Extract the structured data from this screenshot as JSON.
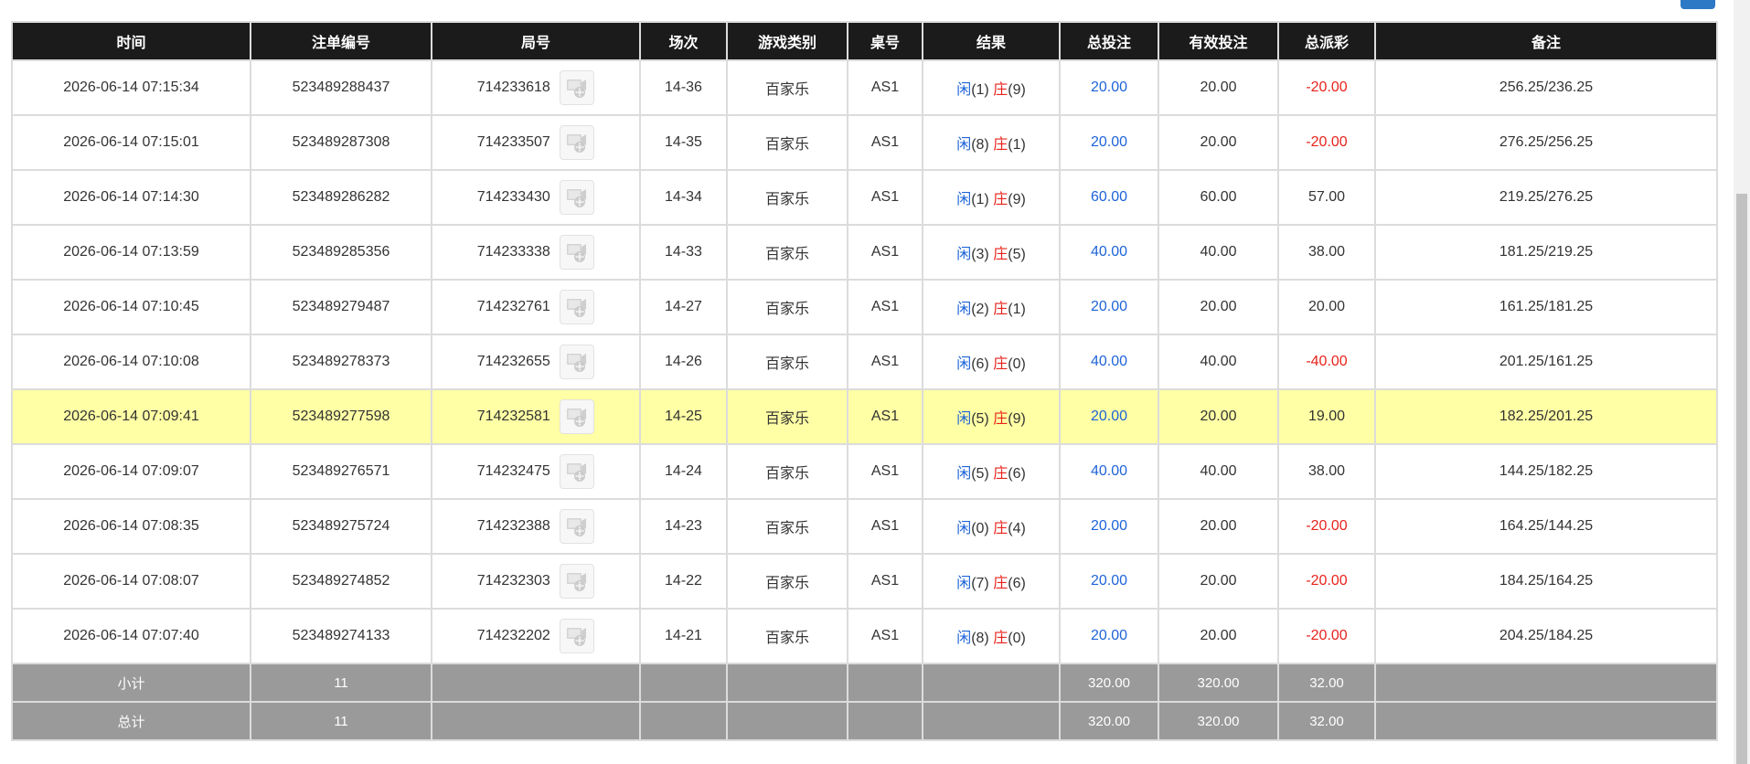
{
  "table": {
    "headers": [
      "时间",
      "注单编号",
      "局号",
      "场次",
      "游戏类别",
      "桌号",
      "结果",
      "总投注",
      "有效投注",
      "总派彩",
      "备注"
    ],
    "rows": [
      {
        "time": "2026-06-14 07:15:34",
        "bet_id": "523489288437",
        "round_id": "714233618",
        "session": "14-36",
        "game_type": "百家乐",
        "table_no": "AS1",
        "player_label": "闲",
        "player_score": "(1)",
        "banker_label": "庄",
        "banker_score": "(9)",
        "total_bet": "20.00",
        "valid_bet": "20.00",
        "payout": "-20.00",
        "note": "256.25/236.25"
      },
      {
        "time": "2026-06-14 07:15:01",
        "bet_id": "523489287308",
        "round_id": "714233507",
        "session": "14-35",
        "game_type": "百家乐",
        "table_no": "AS1",
        "player_label": "闲",
        "player_score": "(8)",
        "banker_label": "庄",
        "banker_score": "(1)",
        "total_bet": "20.00",
        "valid_bet": "20.00",
        "payout": "-20.00",
        "note": "276.25/256.25"
      },
      {
        "time": "2026-06-14 07:14:30",
        "bet_id": "523489286282",
        "round_id": "714233430",
        "session": "14-34",
        "game_type": "百家乐",
        "table_no": "AS1",
        "player_label": "闲",
        "player_score": "(1)",
        "banker_label": "庄",
        "banker_score": "(9)",
        "total_bet": "60.00",
        "valid_bet": "60.00",
        "payout": "57.00",
        "note": "219.25/276.25"
      },
      {
        "time": "2026-06-14 07:13:59",
        "bet_id": "523489285356",
        "round_id": "714233338",
        "session": "14-33",
        "game_type": "百家乐",
        "table_no": "AS1",
        "player_label": "闲",
        "player_score": "(3)",
        "banker_label": "庄",
        "banker_score": "(5)",
        "total_bet": "40.00",
        "valid_bet": "40.00",
        "payout": "38.00",
        "note": "181.25/219.25"
      },
      {
        "time": "2026-06-14 07:10:45",
        "bet_id": "523489279487",
        "round_id": "714232761",
        "session": "14-27",
        "game_type": "百家乐",
        "table_no": "AS1",
        "player_label": "闲",
        "player_score": "(2)",
        "banker_label": "庄",
        "banker_score": "(1)",
        "total_bet": "20.00",
        "valid_bet": "20.00",
        "payout": "20.00",
        "note": "161.25/181.25"
      },
      {
        "time": "2026-06-14 07:10:08",
        "bet_id": "523489278373",
        "round_id": "714232655",
        "session": "14-26",
        "game_type": "百家乐",
        "table_no": "AS1",
        "player_label": "闲",
        "player_score": "(6)",
        "banker_label": "庄",
        "banker_score": "(0)",
        "total_bet": "40.00",
        "valid_bet": "40.00",
        "payout": "-40.00",
        "note": "201.25/161.25"
      },
      {
        "time": "2026-06-14 07:09:41",
        "bet_id": "523489277598",
        "round_id": "714232581",
        "session": "14-25",
        "game_type": "百家乐",
        "table_no": "AS1",
        "player_label": "闲",
        "player_score": "(5)",
        "banker_label": "庄",
        "banker_score": "(9)",
        "total_bet": "20.00",
        "valid_bet": "20.00",
        "payout": "19.00",
        "note": "182.25/201.25"
      },
      {
        "time": "2026-06-14 07:09:07",
        "bet_id": "523489276571",
        "round_id": "714232475",
        "session": "14-24",
        "game_type": "百家乐",
        "table_no": "AS1",
        "player_label": "闲",
        "player_score": "(5)",
        "banker_label": "庄",
        "banker_score": "(6)",
        "total_bet": "40.00",
        "valid_bet": "40.00",
        "payout": "38.00",
        "note": "144.25/182.25"
      },
      {
        "time": "2026-06-14 07:08:35",
        "bet_id": "523489275724",
        "round_id": "714232388",
        "session": "14-23",
        "game_type": "百家乐",
        "table_no": "AS1",
        "player_label": "闲",
        "player_score": "(0)",
        "banker_label": "庄",
        "banker_score": "(4)",
        "total_bet": "20.00",
        "valid_bet": "20.00",
        "payout": "-20.00",
        "note": "164.25/144.25"
      },
      {
        "time": "2026-06-14 07:08:07",
        "bet_id": "523489274852",
        "round_id": "714232303",
        "session": "14-22",
        "game_type": "百家乐",
        "table_no": "AS1",
        "player_label": "闲",
        "player_score": "(7)",
        "banker_label": "庄",
        "banker_score": "(6)",
        "total_bet": "20.00",
        "valid_bet": "20.00",
        "payout": "-20.00",
        "note": "184.25/164.25"
      },
      {
        "time": "2026-06-14 07:07:40",
        "bet_id": "523489274133",
        "round_id": "714232202",
        "session": "14-21",
        "game_type": "百家乐",
        "table_no": "AS1",
        "player_label": "闲",
        "player_score": "(8)",
        "banker_label": "庄",
        "banker_score": "(0)",
        "total_bet": "20.00",
        "valid_bet": "20.00",
        "payout": "-20.00",
        "note": "204.25/184.25"
      }
    ],
    "highlighted_row": 6,
    "subtotal": {
      "label": "小计",
      "count": "11",
      "total_bet": "320.00",
      "valid_bet": "320.00",
      "payout": "32.00"
    },
    "grand_total": {
      "label": "总计",
      "count": "11",
      "total_bet": "320.00",
      "valid_bet": "320.00",
      "payout": "32.00"
    }
  },
  "icons": {
    "replay": "video-replay-icon"
  },
  "colors": {
    "header_bg": "#1b1b1b",
    "footer_bg": "#9a9a9a",
    "highlight_bg": "#ffffa5",
    "positive_blue": "#1e64d8",
    "negative_red": "#e8231c"
  }
}
